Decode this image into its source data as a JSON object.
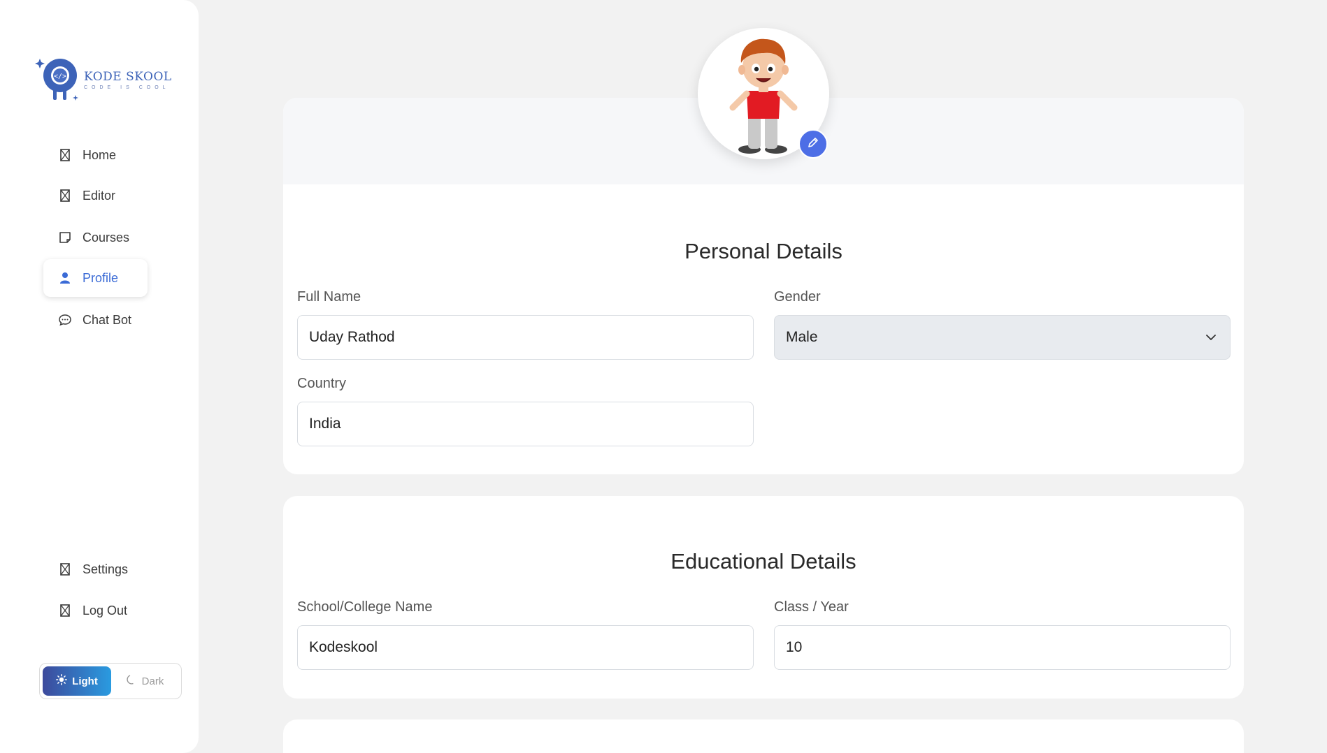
{
  "brand": {
    "name": "KODE SKOOL",
    "tagline": "CODE IS COOL",
    "color": "#3d63b8"
  },
  "sidebar": {
    "items": [
      {
        "label": "Home",
        "icon": "broken-image-icon"
      },
      {
        "label": "Editor",
        "icon": "broken-image-icon"
      },
      {
        "label": "Courses",
        "icon": "note-icon"
      },
      {
        "label": "Profile",
        "icon": "user-icon",
        "active": true
      },
      {
        "label": "Chat Bot",
        "icon": "chat-icon"
      }
    ],
    "bottom_items": [
      {
        "label": "Settings",
        "icon": "broken-image-icon"
      },
      {
        "label": "Log Out",
        "icon": "broken-image-icon"
      }
    ],
    "theme": {
      "light_label": "Light",
      "dark_label": "Dark",
      "selected": "Light"
    }
  },
  "profile": {
    "avatar_icon": "cartoon-boy-avatar",
    "edit_icon": "pencil-icon"
  },
  "personal": {
    "title": "Personal Details",
    "full_name_label": "Full Name",
    "full_name": "Uday Rathod",
    "gender_label": "Gender",
    "gender": "Male",
    "country_label": "Country",
    "country": "India"
  },
  "education": {
    "title": "Educational Details",
    "school_label": "School/College Name",
    "school": "Kodeskool",
    "class_label": "Class / Year",
    "class": "10"
  },
  "colors": {
    "accent": "#3b6bd6",
    "edit_button": "#4d6ee6",
    "page_bg": "#f2f2f2"
  }
}
